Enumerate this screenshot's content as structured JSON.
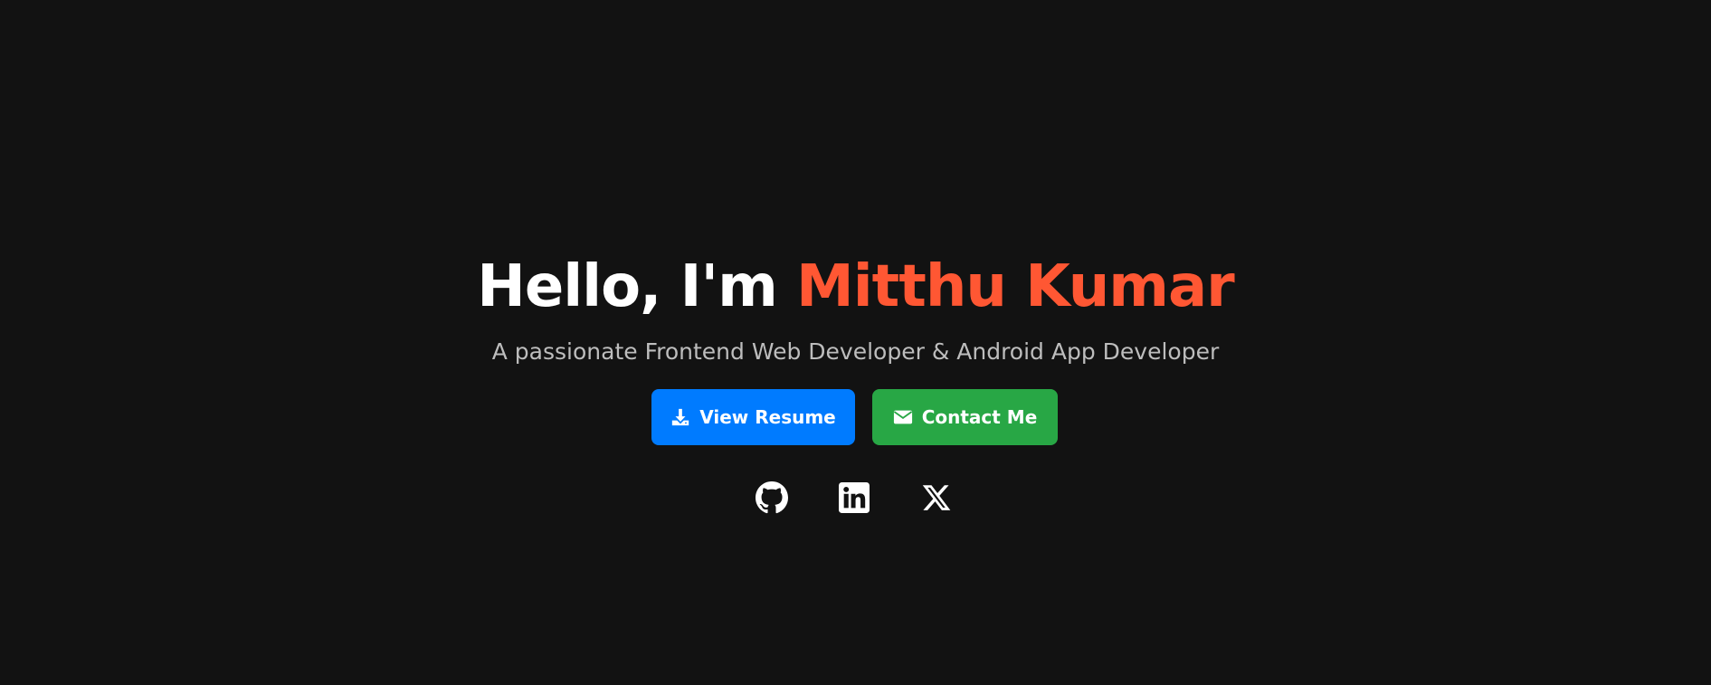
{
  "hero": {
    "greeting": "Hello, I'm",
    "name": "Mitthu Kumar",
    "tagline": "A passionate Frontend Web Developer & Android App Developer"
  },
  "buttons": {
    "resume_label": "View Resume",
    "resume_icon": "download-icon",
    "contact_label": "Contact Me",
    "contact_icon": "envelope-icon"
  },
  "social": [
    {
      "icon": "github-icon"
    },
    {
      "icon": "linkedin-icon"
    },
    {
      "icon": "x-twitter-icon"
    }
  ],
  "colors": {
    "background": "#121212",
    "accent": "#ff5733",
    "primary_button": "#007bff",
    "success_button": "#28a745",
    "tagline": "#bdbdbd"
  }
}
